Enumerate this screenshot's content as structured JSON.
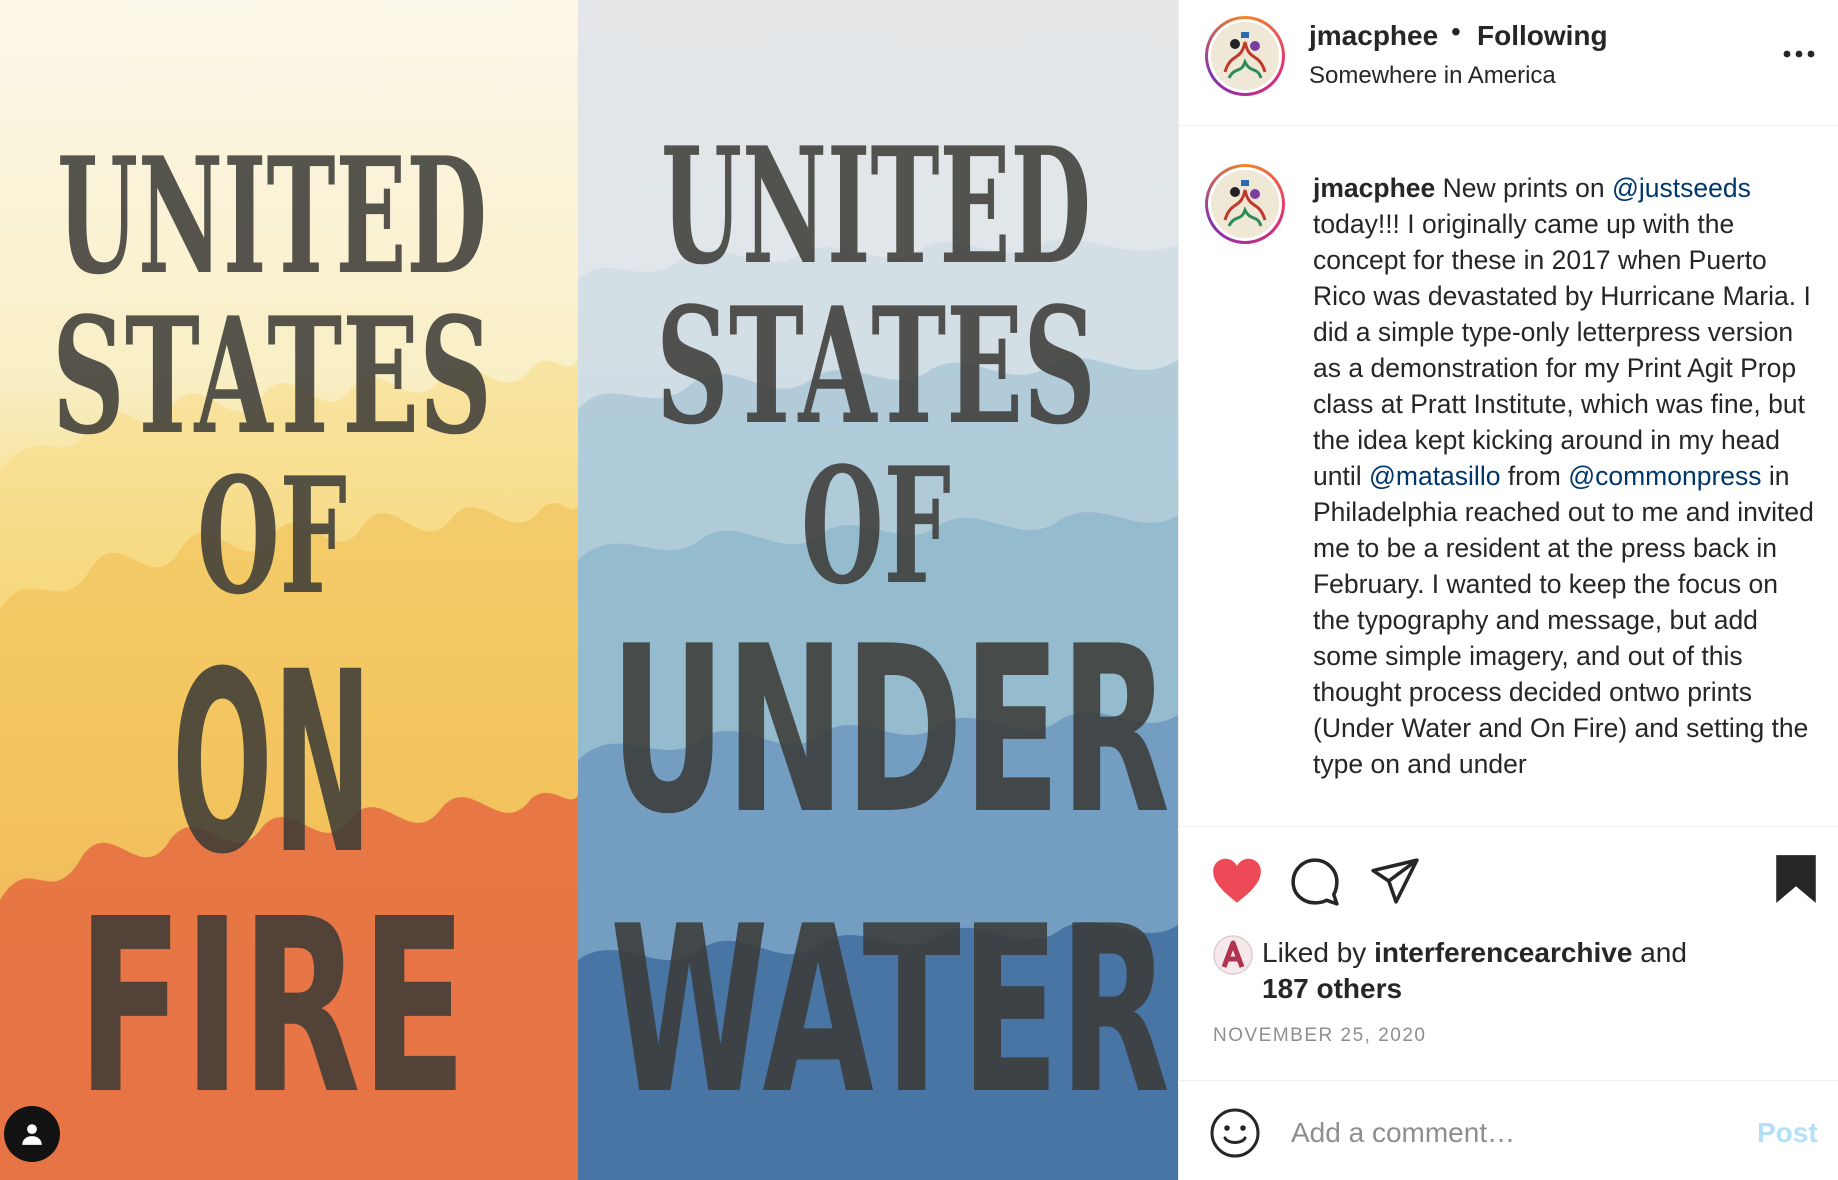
{
  "post_image": {
    "left_poster": {
      "lines": [
        "UNITED",
        "STATES",
        "OF",
        "ON",
        "FIRE"
      ]
    },
    "right_poster": {
      "lines": [
        "UNITED",
        "STATES",
        "OF",
        "UNDER",
        "WATER"
      ]
    },
    "tag_icon": "user-icon"
  },
  "header": {
    "username": "jmacphee",
    "separator": "•",
    "follow_status": "Following",
    "location": "Somewhere in America",
    "more_icon": "more-horizontal-icon"
  },
  "caption": {
    "username": "jmacphee",
    "segments": [
      {
        "text": " New prints on ",
        "type": "text"
      },
      {
        "text": "@justseeds",
        "type": "mention"
      },
      {
        "text": " today!!! I originally came up with the concept for these in 2017 when Puerto Rico was devastated by Hurricane Maria. I did a simple type-only letterpress version as a demonstration for my Print Agit Prop class at Pratt Institute, which was fine, but the idea kept kicking around in my head until ",
        "type": "text"
      },
      {
        "text": "@matasillo",
        "type": "mention"
      },
      {
        "text": " from ",
        "type": "text"
      },
      {
        "text": "@commonpress",
        "type": "mention"
      },
      {
        "text": " in Philadelphia reached out to me and invited me to be a resident at the press back in February. I wanted to keep the focus on the typography and message, but add some simple imagery, and out of this thought process decided ontwo prints (Under Water and On Fire) and setting the type on and under",
        "type": "text"
      }
    ]
  },
  "actions": {
    "like_icon": "heart-filled-icon",
    "comment_icon": "comment-icon",
    "share_icon": "send-icon",
    "save_icon": "bookmark-filled-icon",
    "like_color": "#ed4956"
  },
  "likes": {
    "prefix": "Liked by ",
    "user": "interferencearchive",
    "suffix": " and",
    "others": "187 others"
  },
  "date": "NOVEMBER 25, 2020",
  "comment_box": {
    "emoji_icon": "smiley-icon",
    "placeholder": "Add a comment…",
    "post_label": "Post",
    "post_color": "#b2dffc"
  },
  "colors": {
    "mention": "#00376b",
    "muted": "#8e8e8e",
    "text": "#262626"
  }
}
